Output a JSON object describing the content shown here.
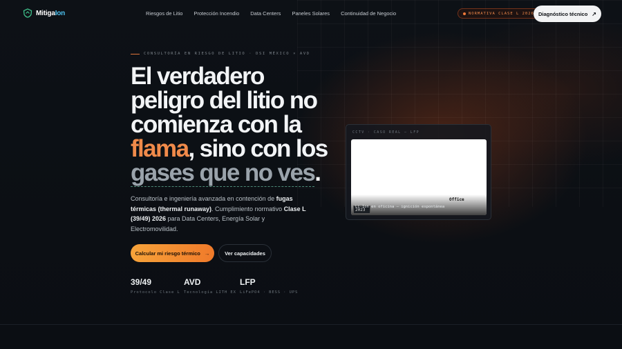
{
  "nav": {
    "logo_part1": "Mitiga",
    "logo_part2": "Ion",
    "menu": [
      "Riesgos de Litio",
      "Protección Incendio",
      "Data Centers",
      "Paneles Solares",
      "Continuidad de Negocio"
    ],
    "badge": "NORMATIVA CLASE L 2026",
    "cta": "Diagnóstico técnico"
  },
  "hero": {
    "eyebrow": "CONSULTORÍA EN RIESGO DE LITIO · DSI MÉXICO × AVD",
    "headline": {
      "l1": "El verdadero",
      "l2": "peligro del litio no",
      "l3": "comienza con la",
      "l4_accent": "flama",
      "l4_rest": ", sino con los",
      "l5_muted": "gases que no ves",
      "l5_end": "."
    },
    "desc": {
      "p1": "Consultoría e ingeniería avanzada en contención de ",
      "b1": "fugas térmicas (thermal runaway)",
      "p2": ". Cumplimiento normativo ",
      "b2": "Clase L (39/49) 2026",
      "p3": " para Data Centers, Energía Solar y Electromovilidad."
    },
    "cta_primary": "Calcular mi riesgo térmico",
    "cta_secondary": "Ver capacidades",
    "stats": [
      {
        "value": "39/49",
        "label": "Protocolo Clase L"
      },
      {
        "value": "AVD",
        "label": "Tecnología LITH EX"
      },
      {
        "value": "LFP",
        "label": "LiFePO4 · BESS · UPS"
      }
    ]
  },
  "video": {
    "label": "CCTV · CASO REAL — LFP",
    "office": "Office",
    "year": "2023",
    "caption": "Li-Ion en oficina — ignición espontánea"
  },
  "colors": {
    "accent": "#f08a4a",
    "brand": "#4cc1f0",
    "background": "#0c0f14"
  }
}
